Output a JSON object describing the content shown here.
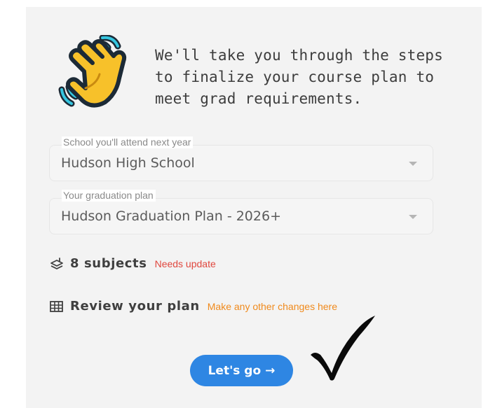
{
  "intro": {
    "line1": "We'll take you through the steps",
    "line2": "to finalize your course plan to",
    "line3": "meet grad requirements."
  },
  "school": {
    "label": "School you'll attend next year",
    "value": "Hudson High School"
  },
  "plan": {
    "label": "Your graduation plan",
    "value": "Hudson Graduation Plan - 2026+"
  },
  "subjects": {
    "title": "8 subjects",
    "note": "Needs update",
    "icon": "layers-icon"
  },
  "review": {
    "title": "Review your plan",
    "note": "Make any other changes here",
    "icon": "grid-icon"
  },
  "action": {
    "label": "Let's go",
    "arrow": "→"
  },
  "colors": {
    "card_bg": "#f3f3f3",
    "button": "#2e86e3",
    "needs_update": "#e0473e",
    "changes_hint": "#f08a1c"
  }
}
